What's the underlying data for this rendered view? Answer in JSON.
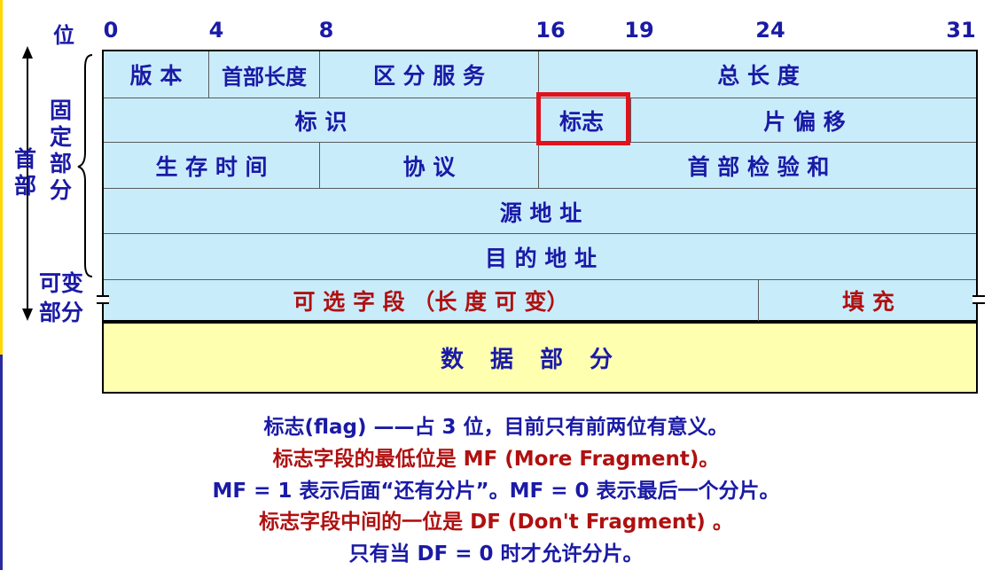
{
  "bit_label": "位",
  "bits": [
    "0",
    "4",
    "8",
    "16",
    "19",
    "24",
    "31"
  ],
  "rows": {
    "r1": {
      "version": "版 本",
      "hlen": "首部长度",
      "tos": "区 分 服 务",
      "total_len": "总   长   度"
    },
    "r2": {
      "ident": "标    识",
      "flag": "标志",
      "frag_offset": "片   偏   移"
    },
    "r3": {
      "ttl": "生 存 时 间",
      "protocol": "协    议",
      "checksum": "首   部   检   验   和"
    },
    "r4": {
      "src": "源   地   址"
    },
    "r5": {
      "dst": "目   的   地   址"
    },
    "r6": {
      "options": "可   选   字   段  （长   度   可   变）",
      "padding": "填     充"
    }
  },
  "data_part": "数据部分",
  "side": {
    "header": "首部",
    "fixed_part": "固定部分",
    "variable_part_1": "可变",
    "variable_part_2": "部分"
  },
  "notes": [
    "标志(flag) ——占 3 位，目前只有前两位有意义。",
    "标志字段的最低位是 MF (More Fragment)。",
    "MF = 1 表示后面“还有分片”。MF = 0 表示最后一个分片。",
    "标志字段中间的一位是 DF (Don't Fragment) 。",
    "只有当 DF = 0 时才允许分片。"
  ],
  "colors": {
    "cell_bg": "#c9ecfb",
    "data_bg": "#ffffb0",
    "highlight": "#e0121b",
    "text_blue": "#1a1aa6",
    "text_red": "#b01010"
  }
}
